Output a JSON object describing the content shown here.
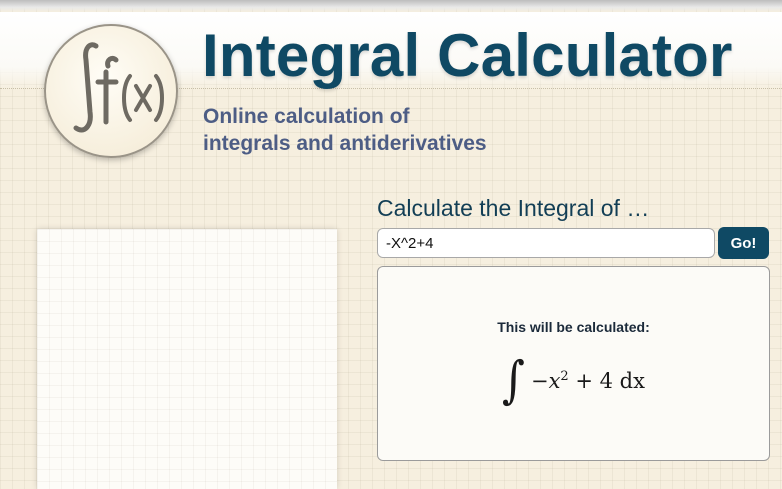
{
  "header": {
    "logo_text": "∫f(x)",
    "title": "Integral Calculator",
    "subtitle_line1": "Online calculation of",
    "subtitle_line2": "integrals and antiderivatives"
  },
  "calculator": {
    "heading": "Calculate the Integral of …",
    "input_value": "-X^2+4",
    "go_label": "Go!",
    "preview_label": "This will be calculated:",
    "formula": {
      "integral_sign": "∫",
      "minus": "−",
      "variable": "x",
      "exponent": "2",
      "rest": " + 4",
      "differential": " dx"
    }
  },
  "colors": {
    "brand": "#0f4964",
    "subtitle": "#4d5d85",
    "background": "#f6efdf"
  }
}
